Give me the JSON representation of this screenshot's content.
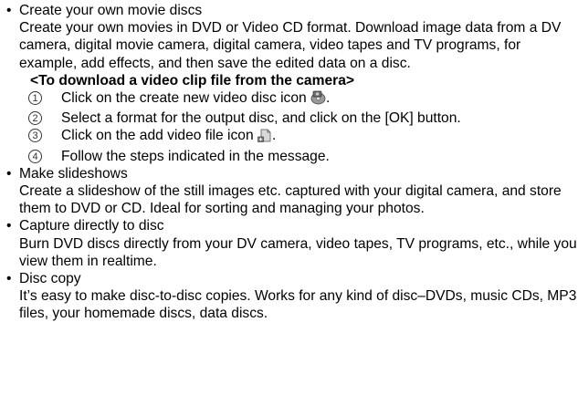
{
  "items": [
    {
      "title": "Create your own movie discs",
      "body": "Create your own movies in DVD or Video CD format. Download image data from a DV camera, digital movie camera, digital camera, video tapes and TV programs, for example, add effects, and then save the edited data on a disc.",
      "subheading": "<To download a video clip file from the camera>",
      "steps": [
        {
          "num": "1",
          "text": "Click on the create new video disc icon",
          "suffix": ".",
          "icon": "create-video-disc-icon"
        },
        {
          "num": "2",
          "text": "Select a format for the output disc, and click on the [OK] button.",
          "suffix": ""
        },
        {
          "num": "3",
          "text": "Click on the add video file icon",
          "suffix": ".",
          "icon": "add-video-file-icon"
        },
        {
          "num": "4",
          "text": "Follow the steps indicated in the message.",
          "suffix": ""
        }
      ]
    },
    {
      "title": "Make slideshows",
      "body": "Create a slideshow of the still images etc. captured with your digital camera, and store them to DVD or CD. Ideal for sorting and managing your photos."
    },
    {
      "title": "Capture directly to disc",
      "body": "Burn DVD discs directly from your DV camera, video tapes, TV programs, etc., while you view them in realtime."
    },
    {
      "title": "Disc copy",
      "body": "It’s easy to make disc-to-disc copies. Works for any kind of disc–DVDs, music CDs, MP3 files, your homemade discs, data discs."
    }
  ],
  "bullet_symbol": "•"
}
